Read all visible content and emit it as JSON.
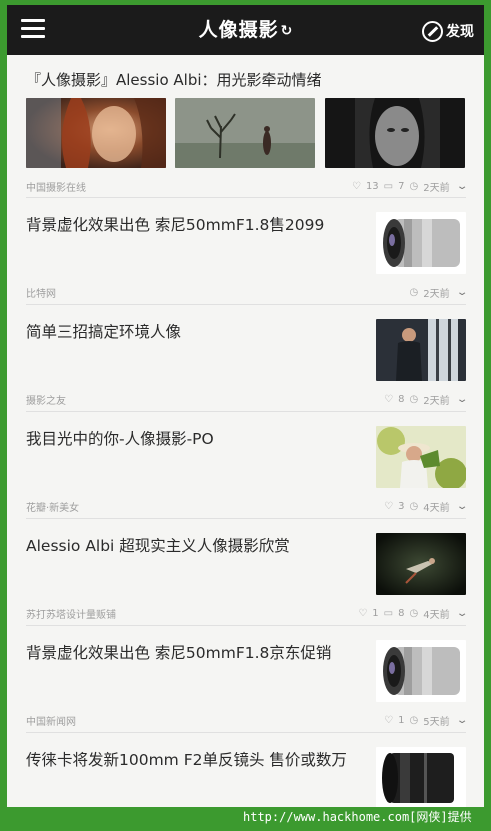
{
  "app": {
    "title": "人像摄影",
    "refresh_icon": "refresh-icon",
    "discover_label": "发现"
  },
  "feed": [
    {
      "title": "『人像摄影』Alessio Albi：用光影牵动情绪",
      "source": "中国摄影在线",
      "likes": "13",
      "comments": "7",
      "time": "2天前",
      "images": [
        "portrait-redhead",
        "bare-tree-fog",
        "bw-woman-face"
      ]
    },
    {
      "title": "背景虚化效果出色 索尼50mmF1.8售2099",
      "source": "比特网",
      "likes": "",
      "comments": "",
      "time": "2天前",
      "images": [
        "camera-lens"
      ]
    },
    {
      "title": "简单三招搞定环境人像",
      "source": "摄影之友",
      "likes": "8",
      "comments": "",
      "time": "2天前",
      "images": [
        "man-by-window"
      ]
    },
    {
      "title": "我目光中的你-人像摄影-PO",
      "source": "花瓣·新美女",
      "likes": "3",
      "comments": "",
      "time": "4天前",
      "images": [
        "girl-with-hat"
      ]
    },
    {
      "title": "Alessio Albi 超现实主义人像摄影欣赏",
      "source": "苏打苏塔设计量贩铺",
      "likes": "1",
      "comments": "8",
      "time": "4天前",
      "images": [
        "dark-floating-figure"
      ]
    },
    {
      "title": "背景虚化效果出色 索尼50mmF1.8京东促销",
      "source": "中国新闻网",
      "likes": "1",
      "comments": "",
      "time": "5天前",
      "images": [
        "camera-lens"
      ]
    },
    {
      "title": "传徕卡将发新100mm F2单反镜头 售价或数万",
      "source": "",
      "likes": "",
      "comments": "",
      "time": "",
      "images": [
        "black-lens"
      ]
    }
  ],
  "watermark": "http://www.hackhome.com[网侠]提供",
  "colors": {
    "topbar": "#1b1b1b",
    "background": "#f5f5f3",
    "frame": "#3c9a2f"
  }
}
